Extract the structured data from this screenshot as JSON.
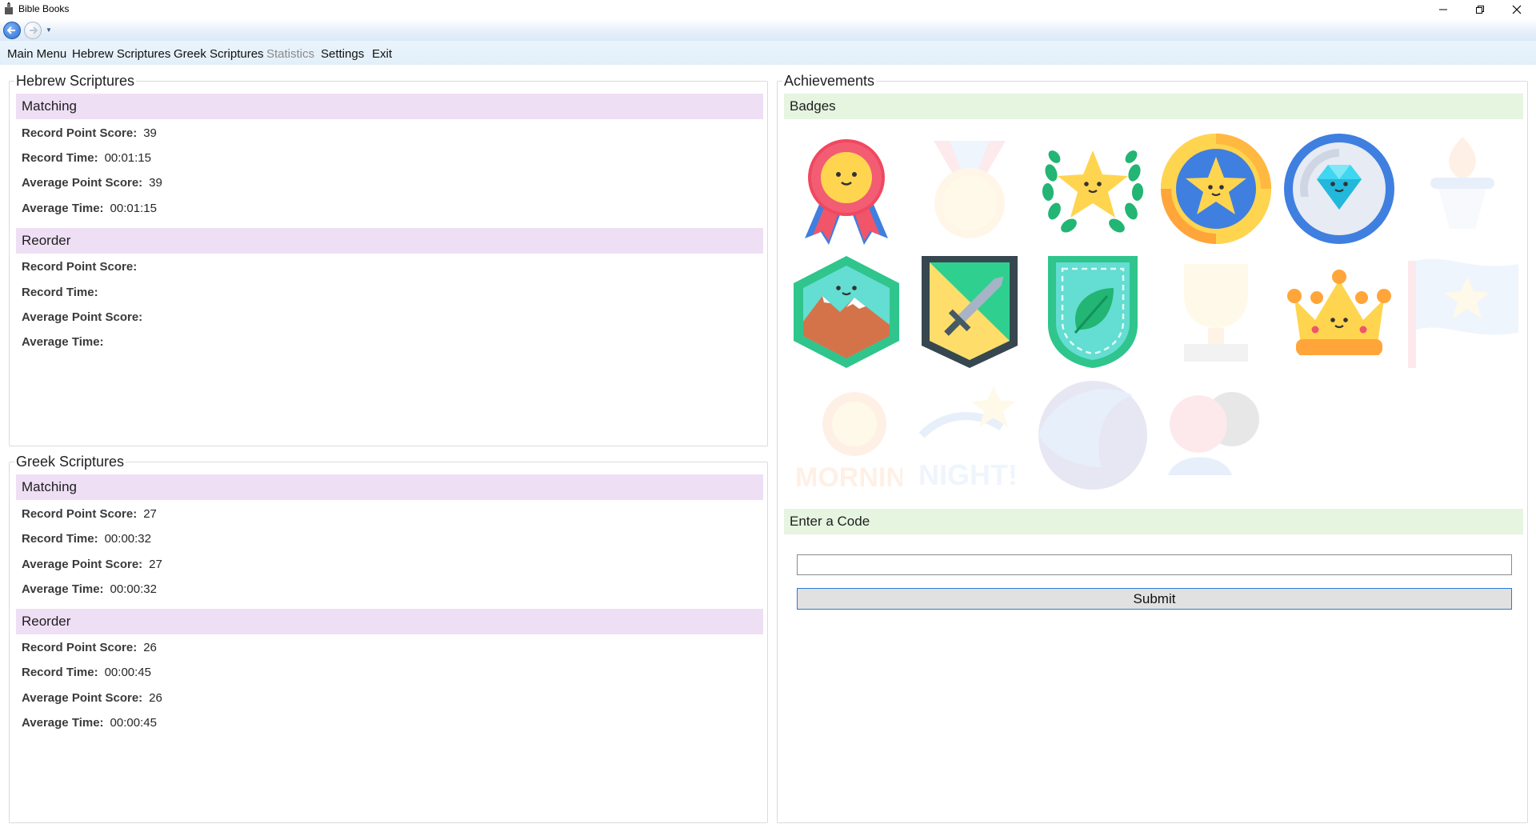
{
  "window": {
    "title": "Bible Books"
  },
  "menu": {
    "items": [
      "Main Menu",
      "Hebrew Scriptures",
      "Greek Scriptures",
      "Statistics",
      "Settings",
      "Exit"
    ],
    "disabled_item": "Statistics"
  },
  "hebrew": {
    "title": "Hebrew Scriptures",
    "matching": {
      "header": "Matching",
      "rows": [
        {
          "label": "Record Point Score:",
          "value": "39"
        },
        {
          "label": "Record Time:",
          "value": "00:01:15"
        },
        {
          "label": "Average Point Score:",
          "value": "39"
        },
        {
          "label": "Average Time:",
          "value": "00:01:15"
        }
      ]
    },
    "reorder": {
      "header": "Reorder",
      "rows": [
        {
          "label": "Record Point Score:",
          "value": ""
        },
        {
          "label": "Record Time:",
          "value": ""
        },
        {
          "label": "Average Point Score:",
          "value": ""
        },
        {
          "label": "Average Time:",
          "value": ""
        }
      ]
    }
  },
  "greek": {
    "title": "Greek Scriptures",
    "matching": {
      "header": "Matching",
      "rows": [
        {
          "label": "Record Point Score:",
          "value": "27"
        },
        {
          "label": "Record Time:",
          "value": "00:00:32"
        },
        {
          "label": "Average Point Score:",
          "value": "27"
        },
        {
          "label": "Average Time:",
          "value": "00:00:32"
        }
      ]
    },
    "reorder": {
      "header": "Reorder",
      "rows": [
        {
          "label": "Record Point Score:",
          "value": "26"
        },
        {
          "label": "Record Time:",
          "value": "00:00:45"
        },
        {
          "label": "Average Point Score:",
          "value": "26"
        },
        {
          "label": "Average Time:",
          "value": "00:00:45"
        }
      ]
    }
  },
  "achievements": {
    "title": "Achievements",
    "badges_header": "Badges",
    "badges": [
      {
        "icon": "rosette-ribbon-icon",
        "unlocked": true
      },
      {
        "icon": "medal-icon",
        "unlocked": false
      },
      {
        "icon": "laurel-star-icon",
        "unlocked": true
      },
      {
        "icon": "star-coin-icon",
        "unlocked": true
      },
      {
        "icon": "diamond-coin-icon",
        "unlocked": true
      },
      {
        "icon": "torch-icon",
        "unlocked": false
      },
      {
        "icon": "mountain-hexagon-icon",
        "unlocked": true
      },
      {
        "icon": "sword-shield-icon",
        "unlocked": true
      },
      {
        "icon": "leaf-shield-icon",
        "unlocked": true
      },
      {
        "icon": "trophy-icon",
        "unlocked": false
      },
      {
        "icon": "crown-icon",
        "unlocked": true
      },
      {
        "icon": "star-flag-icon",
        "unlocked": false
      },
      {
        "icon": "morning-sun-icon",
        "unlocked": false,
        "text": "MORNING!"
      },
      {
        "icon": "night-star-icon",
        "unlocked": false,
        "text": "NIGHT!"
      },
      {
        "icon": "wave-globe-icon",
        "unlocked": false
      },
      {
        "icon": "hug-icon",
        "unlocked": false
      }
    ],
    "code_header": "Enter a Code",
    "code_value": "",
    "submit_label": "Submit"
  },
  "colors": {
    "section_purple": "#efdff5",
    "section_green": "#e5f5e0",
    "menu_bg": "#e2eff9",
    "submit_border": "#2a7ad8"
  }
}
